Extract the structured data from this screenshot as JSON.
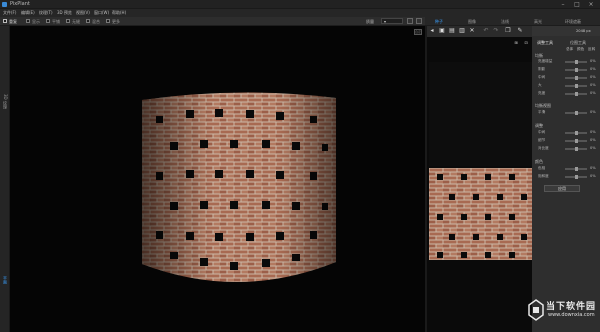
{
  "window": {
    "title": "PixPlant"
  },
  "menu": [
    "文件(F)",
    "编辑(E)",
    "纹理(T)",
    "3D 预览",
    "视图(V)",
    "窗口(W)",
    "帮助(H)"
  ],
  "toolbar": {
    "tile_label": "重复",
    "options": [
      "显示",
      "平铺",
      "无缝",
      "混合",
      "更多"
    ],
    "zoom_select": "质量"
  },
  "left_strip": {
    "top_label": "3D 纹理",
    "bottom_label": "平面"
  },
  "viewport": {
    "corner_label": "自定"
  },
  "right_tabs": {
    "items": [
      "种子",
      "图像",
      "法线",
      "高光",
      "环境遮蔽"
    ],
    "active": 0
  },
  "props": {
    "size_value": "2048 px",
    "header_tabs": [
      "调整工具",
      "位图工具"
    ],
    "sub_tabs": [
      "总体",
      "颜色",
      "反转"
    ],
    "sections": [
      {
        "title": "均衡",
        "rows": [
          "亮度增益",
          "阴影",
          "中间",
          "大",
          "亮度"
        ]
      },
      {
        "title": "均衡视图",
        "rows": [
          "平滑"
        ]
      },
      {
        "title": "调整",
        "rows": [
          "中间",
          "细节",
          "对比度"
        ]
      },
      {
        "title": "颜色",
        "rows": [
          "色相",
          "饱和度"
        ]
      }
    ],
    "row_value": "0%",
    "ok_label": "应用"
  },
  "watermark": {
    "cn": "当下软件园",
    "url": "www.downxia.com"
  },
  "colors": {
    "accent": "#3aa0ff",
    "brick": "#a86a52",
    "mortar": "#cbb8a6",
    "hole": "#0a0a0a"
  }
}
